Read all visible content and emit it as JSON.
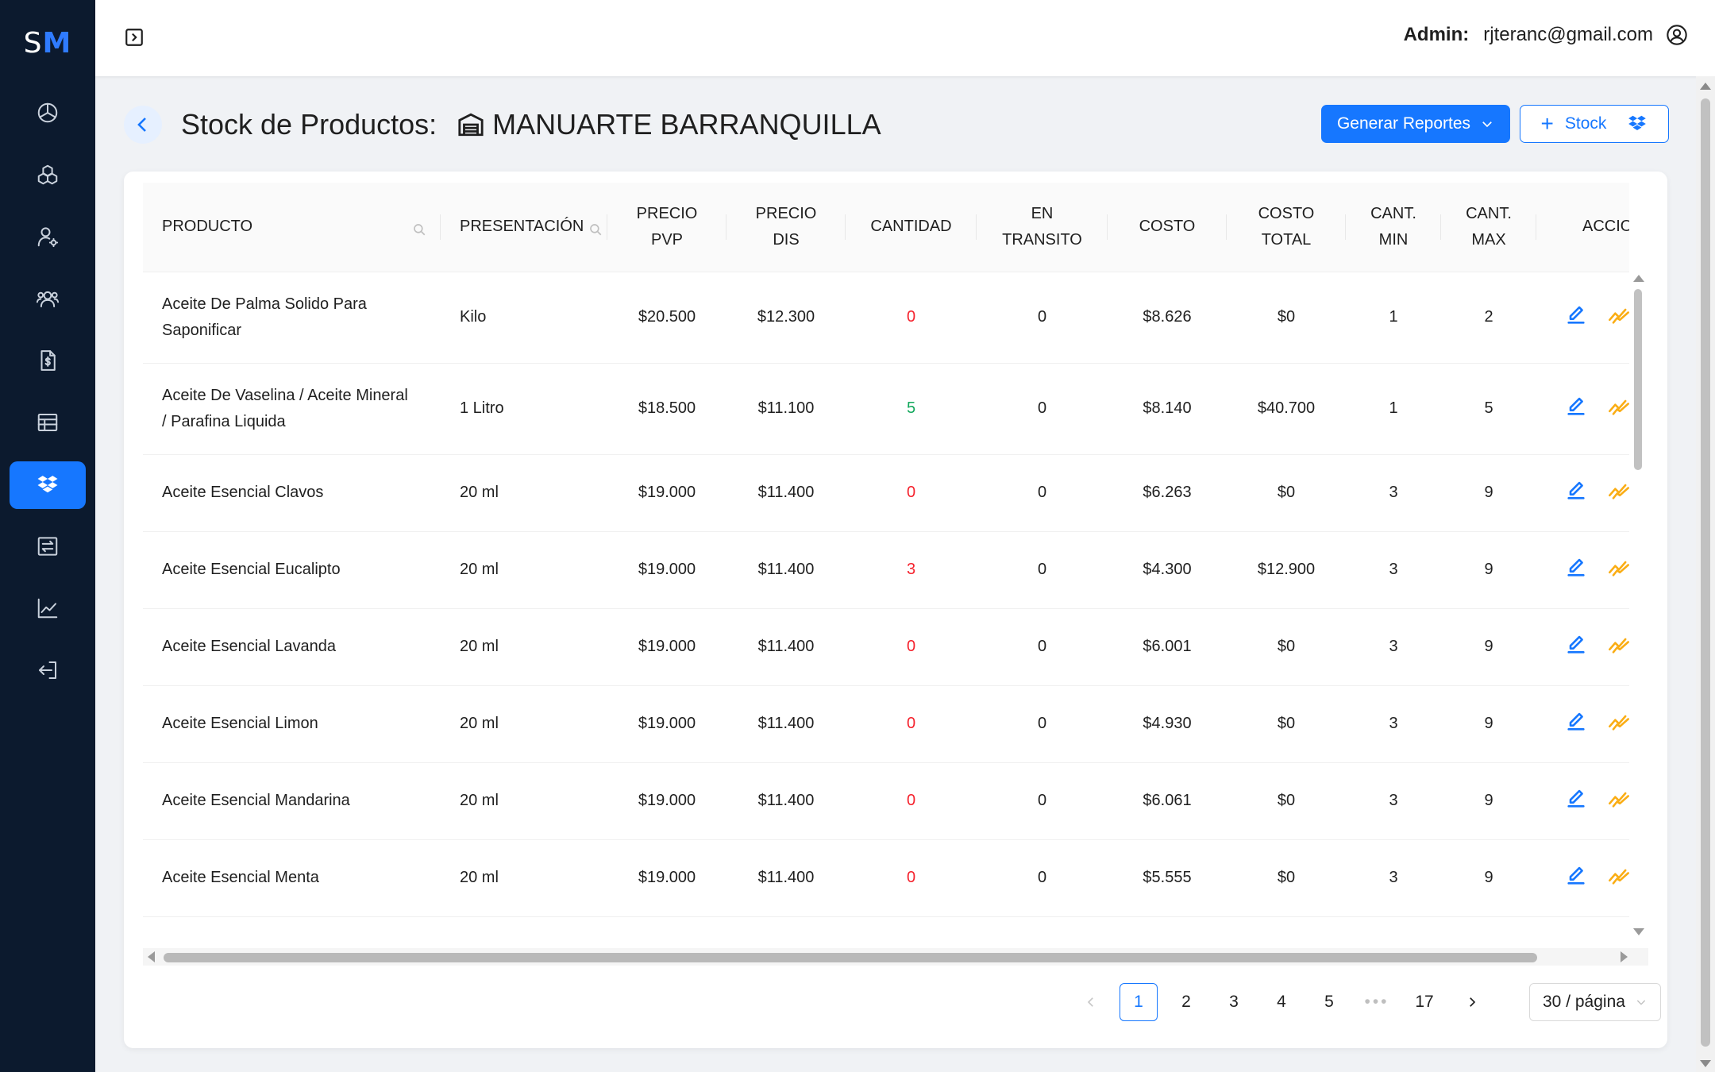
{
  "logo": {
    "s": "S",
    "m": "M"
  },
  "header": {
    "admin_label": "Admin:",
    "admin_email": "rjteranc@gmail.com"
  },
  "page": {
    "title": "Stock de Productos:",
    "store_name": "MANUARTE BARRANQUILLA"
  },
  "actions": {
    "reports_label": "Generar Reportes",
    "stock_label": "Stock"
  },
  "sidebar": {
    "items": [
      {
        "icon": "dashboard-icon"
      },
      {
        "icon": "products-icon"
      },
      {
        "icon": "user-settings-icon"
      },
      {
        "icon": "users-icon"
      },
      {
        "icon": "invoice-icon"
      },
      {
        "icon": "table-list-icon"
      },
      {
        "icon": "stock-icon",
        "active": true
      },
      {
        "icon": "transfer-icon"
      },
      {
        "icon": "chart-icon"
      },
      {
        "icon": "logout-icon"
      }
    ]
  },
  "table": {
    "columns": {
      "producto": "PRODUCTO",
      "presentacion": "PRESENTACIÓN",
      "pvp_1": "PRECIO",
      "pvp_2": "PVP",
      "dis_1": "PRECIO",
      "dis_2": "DIS",
      "cantidad": "CANTIDAD",
      "transito_1": "EN",
      "transito_2": "TRANSITO",
      "costo": "COSTO",
      "total_1": "COSTO",
      "total_2": "TOTAL",
      "min_1": "CANT.",
      "min_2": "MIN",
      "max_1": "CANT.",
      "max_2": "MAX",
      "acciones": "ACCIONES"
    },
    "rows": [
      {
        "producto_1": "Aceite De Palma Solido Para",
        "producto_2": "Saponificar",
        "presentacion": "Kilo",
        "pvp": "$20.500",
        "dis": "$12.300",
        "cantidad": "0",
        "cantidad_status": "red",
        "transito": "0",
        "costo": "$8.626",
        "total": "$0",
        "min": "1",
        "max": "2"
      },
      {
        "producto_1": "Aceite De Vaselina / Aceite Mineral",
        "producto_2": "/ Parafina Liquida",
        "presentacion": "1 Litro",
        "pvp": "$18.500",
        "dis": "$11.100",
        "cantidad": "5",
        "cantidad_status": "green",
        "transito": "0",
        "costo": "$8.140",
        "total": "$40.700",
        "min": "1",
        "max": "5"
      },
      {
        "producto_1": "Aceite Esencial Clavos",
        "producto_2": "",
        "presentacion": "20 ml",
        "pvp": "$19.000",
        "dis": "$11.400",
        "cantidad": "0",
        "cantidad_status": "red",
        "transito": "0",
        "costo": "$6.263",
        "total": "$0",
        "min": "3",
        "max": "9"
      },
      {
        "producto_1": "Aceite Esencial Eucalipto",
        "producto_2": "",
        "presentacion": "20 ml",
        "pvp": "$19.000",
        "dis": "$11.400",
        "cantidad": "3",
        "cantidad_status": "red",
        "transito": "0",
        "costo": "$4.300",
        "total": "$12.900",
        "min": "3",
        "max": "9"
      },
      {
        "producto_1": "Aceite Esencial Lavanda",
        "producto_2": "",
        "presentacion": "20 ml",
        "pvp": "$19.000",
        "dis": "$11.400",
        "cantidad": "0",
        "cantidad_status": "red",
        "transito": "0",
        "costo": "$6.001",
        "total": "$0",
        "min": "3",
        "max": "9"
      },
      {
        "producto_1": "Aceite Esencial Limon",
        "producto_2": "",
        "presentacion": "20 ml",
        "pvp": "$19.000",
        "dis": "$11.400",
        "cantidad": "0",
        "cantidad_status": "red",
        "transito": "0",
        "costo": "$4.930",
        "total": "$0",
        "min": "3",
        "max": "9"
      },
      {
        "producto_1": "Aceite Esencial Mandarina",
        "producto_2": "",
        "presentacion": "20 ml",
        "pvp": "$19.000",
        "dis": "$11.400",
        "cantidad": "0",
        "cantidad_status": "red",
        "transito": "0",
        "costo": "$6.061",
        "total": "$0",
        "min": "3",
        "max": "9"
      },
      {
        "producto_1": "Aceite Esencial Menta",
        "producto_2": "",
        "presentacion": "20 ml",
        "pvp": "$19.000",
        "dis": "$11.400",
        "cantidad": "0",
        "cantidad_status": "red",
        "transito": "0",
        "costo": "$5.555",
        "total": "$0",
        "min": "3",
        "max": "9"
      }
    ]
  },
  "pagination": {
    "pages": [
      "1",
      "2",
      "3",
      "4",
      "5"
    ],
    "ellipsis": "•••",
    "last": "17",
    "current": "1",
    "page_size": "30 / página"
  },
  "colors": {
    "accent": "#1677ff",
    "sidebar": "#0c1a2e",
    "danger": "#f5222d",
    "success": "#13a85c",
    "warning": "#faad14"
  }
}
